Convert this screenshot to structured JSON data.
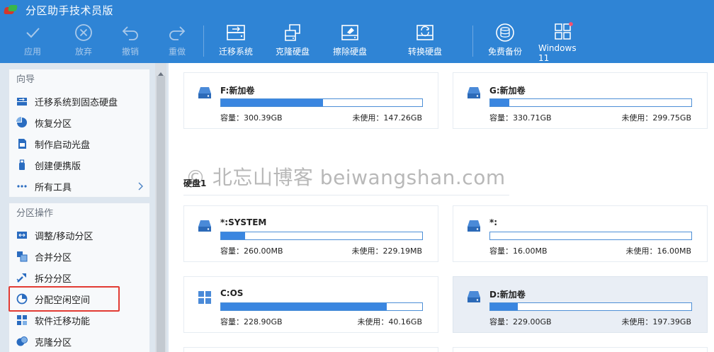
{
  "window": {
    "title": "分区助手技术员版"
  },
  "toolbar": {
    "buttons": [
      {
        "label": "应用",
        "icon": "check-icon",
        "enabled": false
      },
      {
        "label": "放弃",
        "icon": "discard-icon",
        "enabled": false
      },
      {
        "label": "撤销",
        "icon": "undo-icon",
        "enabled": false
      },
      {
        "label": "重做",
        "icon": "redo-icon",
        "enabled": false
      },
      {
        "label": "迁移系统",
        "icon": "migrate-os-icon",
        "enabled": true
      },
      {
        "label": "克隆硬盘",
        "icon": "clone-disk-icon",
        "enabled": true
      },
      {
        "label": "擦除硬盘",
        "icon": "wipe-disk-icon",
        "enabled": true
      },
      {
        "label": "转换硬盘",
        "icon": "convert-disk-icon",
        "enabled": true
      },
      {
        "label": "免费备份",
        "icon": "free-backup-icon",
        "enabled": true
      },
      {
        "label": "Windows 11",
        "icon": "windows11-grid-icon",
        "enabled": true
      }
    ]
  },
  "sidebar": {
    "wizard": {
      "title": "向导",
      "items": [
        {
          "label": "迁移系统到固态硬盘",
          "icon": "migrate-ssd-icon"
        },
        {
          "label": "恢复分区",
          "icon": "recover-partition-icon"
        },
        {
          "label": "制作启动光盘",
          "icon": "bootable-media-icon"
        },
        {
          "label": "创建便携版",
          "icon": "portable-usb-icon"
        },
        {
          "label": "所有工具",
          "icon": "all-tools-icon"
        }
      ]
    },
    "partition_ops": {
      "title": "分区操作",
      "items": [
        {
          "label": "调整/移动分区",
          "icon": "resize-move-icon"
        },
        {
          "label": "合并分区",
          "icon": "merge-partition-icon"
        },
        {
          "label": "拆分分区",
          "icon": "split-partition-icon"
        },
        {
          "label": "分配空闲空间",
          "icon": "allocate-space-icon"
        },
        {
          "label": "软件迁移功能",
          "icon": "app-mover-icon"
        },
        {
          "label": "克隆分区",
          "icon": "clone-partition-icon"
        }
      ]
    }
  },
  "main": {
    "watermark": "© 北忘山博客 beiwangshan.com",
    "disk_label": "硬盘1",
    "partitions_top": [
      {
        "name": "F:新加卷",
        "capacity": "容量：300.39GB",
        "free": "未使用：147.26GB",
        "used_fraction": 0.507
      },
      {
        "name": "G:新加卷",
        "capacity": "容量：330.71GB",
        "free": "未使用：299.75GB",
        "used_fraction": 0.094
      }
    ],
    "partitions_disk1": [
      {
        "name": "*:SYSTEM",
        "capacity": "容量：260.00MB",
        "free": "未使用：229.19MB",
        "used_fraction": 0.118,
        "os": false
      },
      {
        "name": "*:",
        "capacity": "容量：16.00MB",
        "free": "未使用：16.00MB",
        "used_fraction": 0.0,
        "os": false
      },
      {
        "name": "C:OS",
        "capacity": "容量：228.90GB",
        "free": "未使用：40.16GB",
        "used_fraction": 0.825,
        "os": true
      },
      {
        "name": "D:新加卷",
        "capacity": "容量：229.00GB",
        "free": "未使用：197.39GB",
        "used_fraction": 0.138,
        "os": false,
        "selected": true
      }
    ]
  },
  "colors": {
    "toolbar_bg": "#2f84d5",
    "bar_fill": "#3a86e0",
    "highlight": "#e23b33"
  }
}
